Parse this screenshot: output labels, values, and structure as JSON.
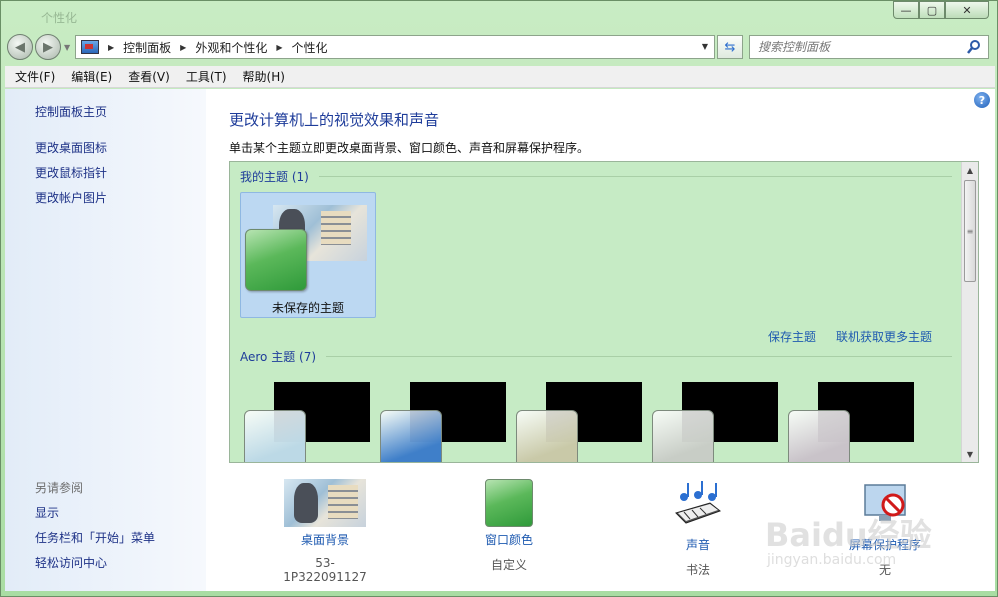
{
  "window": {
    "title": "个性化",
    "caption_min": "▭",
    "caption_max": "▢",
    "caption_close": "✕"
  },
  "address": {
    "crumbs": [
      "控制面板",
      "外观和个性化",
      "个性化"
    ]
  },
  "search": {
    "placeholder": "搜索控制面板"
  },
  "menu": {
    "items": [
      "文件(F)",
      "编辑(E)",
      "查看(V)",
      "工具(T)",
      "帮助(H)"
    ]
  },
  "sidebar": {
    "home": "控制面板主页",
    "links": [
      "更改桌面图标",
      "更改鼠标指针",
      "更改帐户图片"
    ],
    "see_also_heading": "另请参阅",
    "see_also": [
      "显示",
      "任务栏和「开始」菜单",
      "轻松访问中心"
    ]
  },
  "main": {
    "title": "更改计算机上的视觉效果和声音",
    "description": "单击某个主题立即更改桌面背景、窗口颜色、声音和屏幕保护程序。",
    "my_themes_heading": "我的主题 (1)",
    "unsaved_theme_label": "未保存的主题",
    "save_theme_link": "保存主题",
    "get_more_link": "联机获取更多主题",
    "aero_heading": "Aero 主题 (7)"
  },
  "aero_colors": [
    "#bcd9e6",
    "#3f7fc9",
    "#c9c9a8",
    "#c8cdc6",
    "#c9c3c9"
  ],
  "settings": {
    "background": {
      "label": "桌面背景",
      "value": "53-1P322091127"
    },
    "color": {
      "label": "窗口颜色",
      "value": "自定义"
    },
    "sound": {
      "label": "声音",
      "value": "书法"
    },
    "screensaver": {
      "label": "屏幕保护程序",
      "value": "无"
    }
  },
  "watermark": {
    "text": "Baidu经验",
    "url": "jingyan.baidu.com"
  }
}
